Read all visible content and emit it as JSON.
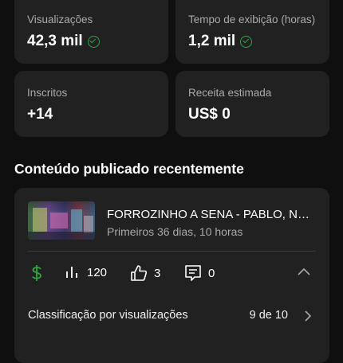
{
  "stats": [
    {
      "label": "Visualizações",
      "value": "42,3 mil",
      "verified": true
    },
    {
      "label": "Tempo de exibição (horas)",
      "value": "1,2 mil",
      "verified": true
    },
    {
      "label": "Inscritos",
      "value": "+14",
      "verified": false
    },
    {
      "label": "Receita estimada",
      "value": "US$ 0",
      "verified": false
    }
  ],
  "section_title": "Conteúdo publicado recentemente",
  "video": {
    "title": "FORROZINHO A SENA - PABLO, NETO",
    "subtitle": "Primeiros 36 dias, 10 horas",
    "views": "120",
    "likes": "3",
    "comments": "0"
  },
  "ranking": {
    "label": "Classificação por visualizações",
    "value": "9 de 10"
  },
  "colors": {
    "background": "#0f0f0f",
    "card": "#212121",
    "accent_green": "#2ba640",
    "secondary_text": "#aaaaaa"
  },
  "icons": [
    "check-circle-icon",
    "dollar-icon",
    "bar-chart-icon",
    "thumbs-up-icon",
    "comment-icon",
    "chevron-up-icon",
    "chevron-right-icon"
  ]
}
